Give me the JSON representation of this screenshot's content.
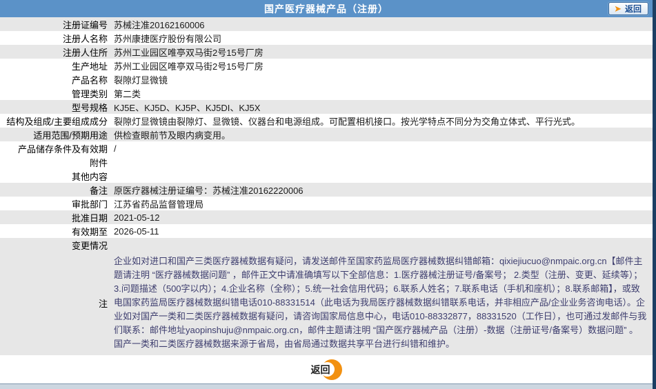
{
  "header": {
    "title": "国产医疗器械产品（注册）",
    "back_button_label": "返回"
  },
  "table": {
    "rows": [
      {
        "label": "注册证编号",
        "value": "苏械注准20162160006",
        "shade": true
      },
      {
        "label": "注册人名称",
        "value": "苏州康捷医疗股份有限公司",
        "shade": false
      },
      {
        "label": "注册人住所",
        "value": "苏州工业园区唯亭双马街2号15号厂房",
        "shade": true
      },
      {
        "label": "生产地址",
        "value": "苏州工业园区唯亭双马街2号15号厂房",
        "shade": false
      },
      {
        "label": "产品名称",
        "value": "裂隙灯显微镜",
        "shade": false
      },
      {
        "label": "管理类别",
        "value": "第二类",
        "shade": false
      },
      {
        "label": "型号规格",
        "value": "KJ5E、KJ5D、KJ5P、KJ5DI、KJ5X",
        "shade": true
      },
      {
        "label": "结构及组成/主要组成成分",
        "value": "裂隙灯显微镜由裂隙灯、显微镜、仪器台和电源组成。可配置相机接口。按光学特点不同分为交角立体式、平行光式。",
        "shade": false
      },
      {
        "label": "适用范围/预期用途",
        "value": "供检查眼前节及眼内病变用。",
        "shade": true
      },
      {
        "label": "产品储存条件及有效期",
        "value": "/",
        "shade": false
      },
      {
        "label": "附件",
        "value": "",
        "shade": false
      },
      {
        "label": "其他内容",
        "value": "",
        "shade": false
      },
      {
        "label": "备注",
        "value": "原医疗器械注册证编号：苏械注准20162220006",
        "shade": true
      },
      {
        "label": "审批部门",
        "value": "江苏省药品监督管理局",
        "shade": false
      },
      {
        "label": "批准日期",
        "value": "2021-05-12",
        "shade": true
      },
      {
        "label": "有效期至",
        "value": "2026-05-11",
        "shade": false
      },
      {
        "label": "变更情况",
        "value": "",
        "shade": true
      }
    ],
    "note": {
      "label": "注",
      "text": "企业如对进口和国产三类医疗器械数据有疑问，请发送邮件至国家药监局医疗器械数据纠错邮箱：qixiejiucuo@nmpaic.org.cn【邮件主题请注明 “医疗器械数据问题” ，邮件正文中请准确填写以下全部信息：1.医疗器械注册证号/备案号； 2.类型（注册、变更、延续等）；3.问题描述（500字以内）；4.企业名称（全称）；5.统一社会信用代码；6.联系人姓名；7.联系电话（手机和座机）；8.联系邮箱】，或致电国家药监局医疗器械数据纠错电话010-88331514（此电话为我局医疗器械数据纠错联系电话，并非相应产品/企业业务咨询电话）。企业如对国产一类和二类医疗器械数据有疑问，请咨询国家局信息中心，电话010-88332877，88331520（工作日），也可通过发邮件与我们联系：邮件地址yaopinshuju@nmpaic.org.cn，邮件主题请注明 “国产医疗器械产品（注册）-数据（注册证号/备案号）数据问题” 。国产一类和二类医疗器械数据来源于省局，由省局通过数据共享平台进行纠错和维护。"
    }
  },
  "footer": {
    "back_button_label": "返回"
  },
  "colors": {
    "header_blue": "#5b92c8",
    "row_gray": "#e7e7e7",
    "note_text_navy": "#3d3d6e",
    "accent_orange": "#f29111",
    "button_text_blue": "#1c4f93",
    "window_edge_navy": "#1c3e63"
  }
}
